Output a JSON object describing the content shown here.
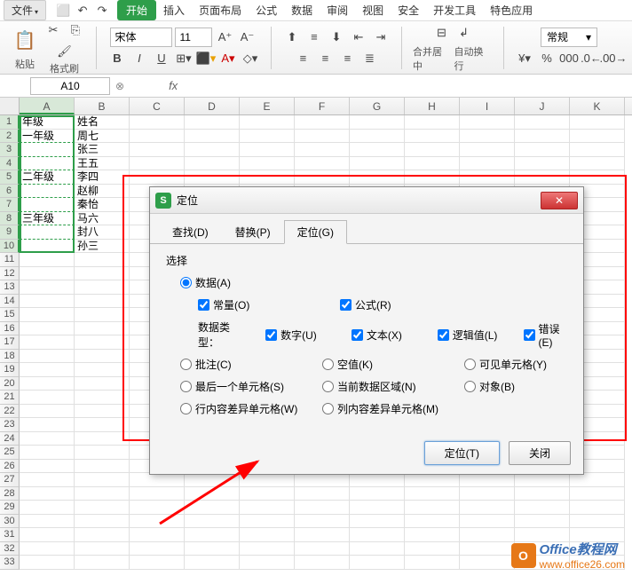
{
  "menubar": {
    "file": "文件",
    "items": [
      "开始",
      "插入",
      "页面布局",
      "公式",
      "数据",
      "审阅",
      "视图",
      "安全",
      "开发工具",
      "特色应用"
    ],
    "active_index": 0
  },
  "toolbar": {
    "paste": "粘贴",
    "format_painter": "格式刷",
    "font_name": "宋体",
    "font_size": "11",
    "merge_center": "合并居中",
    "wrap_text": "自动换行",
    "number_format": "常规"
  },
  "formula_bar": {
    "name_box": "A10",
    "fx": "fx"
  },
  "columns": [
    "A",
    "B",
    "C",
    "D",
    "E",
    "F",
    "G",
    "H",
    "I",
    "J",
    "K"
  ],
  "cells": {
    "A1": "年级",
    "B1": "姓名",
    "A2": "一年级",
    "B2": "周七",
    "B3": "张三",
    "B4": "王五",
    "A5": "二年级",
    "B5": "李四",
    "B6": "赵柳",
    "B7": "秦怡",
    "A8": "三年级",
    "B8": "马六",
    "B9": "封八",
    "B10": "孙三"
  },
  "dialog": {
    "title": "定位",
    "tabs": [
      "查找(D)",
      "替换(P)",
      "定位(G)"
    ],
    "active_tab": 2,
    "select_label": "选择",
    "options": {
      "data": "数据(A)",
      "constant": "常量(O)",
      "formula": "公式(R)",
      "type_label": "数据类型：",
      "number": "数字(U)",
      "text": "文本(X)",
      "logical": "逻辑值(L)",
      "error": "错误(E)",
      "comment": "批注(C)",
      "blank": "空值(K)",
      "visible": "可见单元格(Y)",
      "last": "最后一个单元格(S)",
      "current_region": "当前数据区域(N)",
      "object": "对象(B)",
      "row_diff": "行内容差异单元格(W)",
      "col_diff": "列内容差异单元格(M)"
    },
    "buttons": {
      "locate": "定位(T)",
      "close": "关闭"
    }
  },
  "watermark": {
    "icon": "O",
    "line1": "Office教程网",
    "line2": "www.office26.com"
  }
}
